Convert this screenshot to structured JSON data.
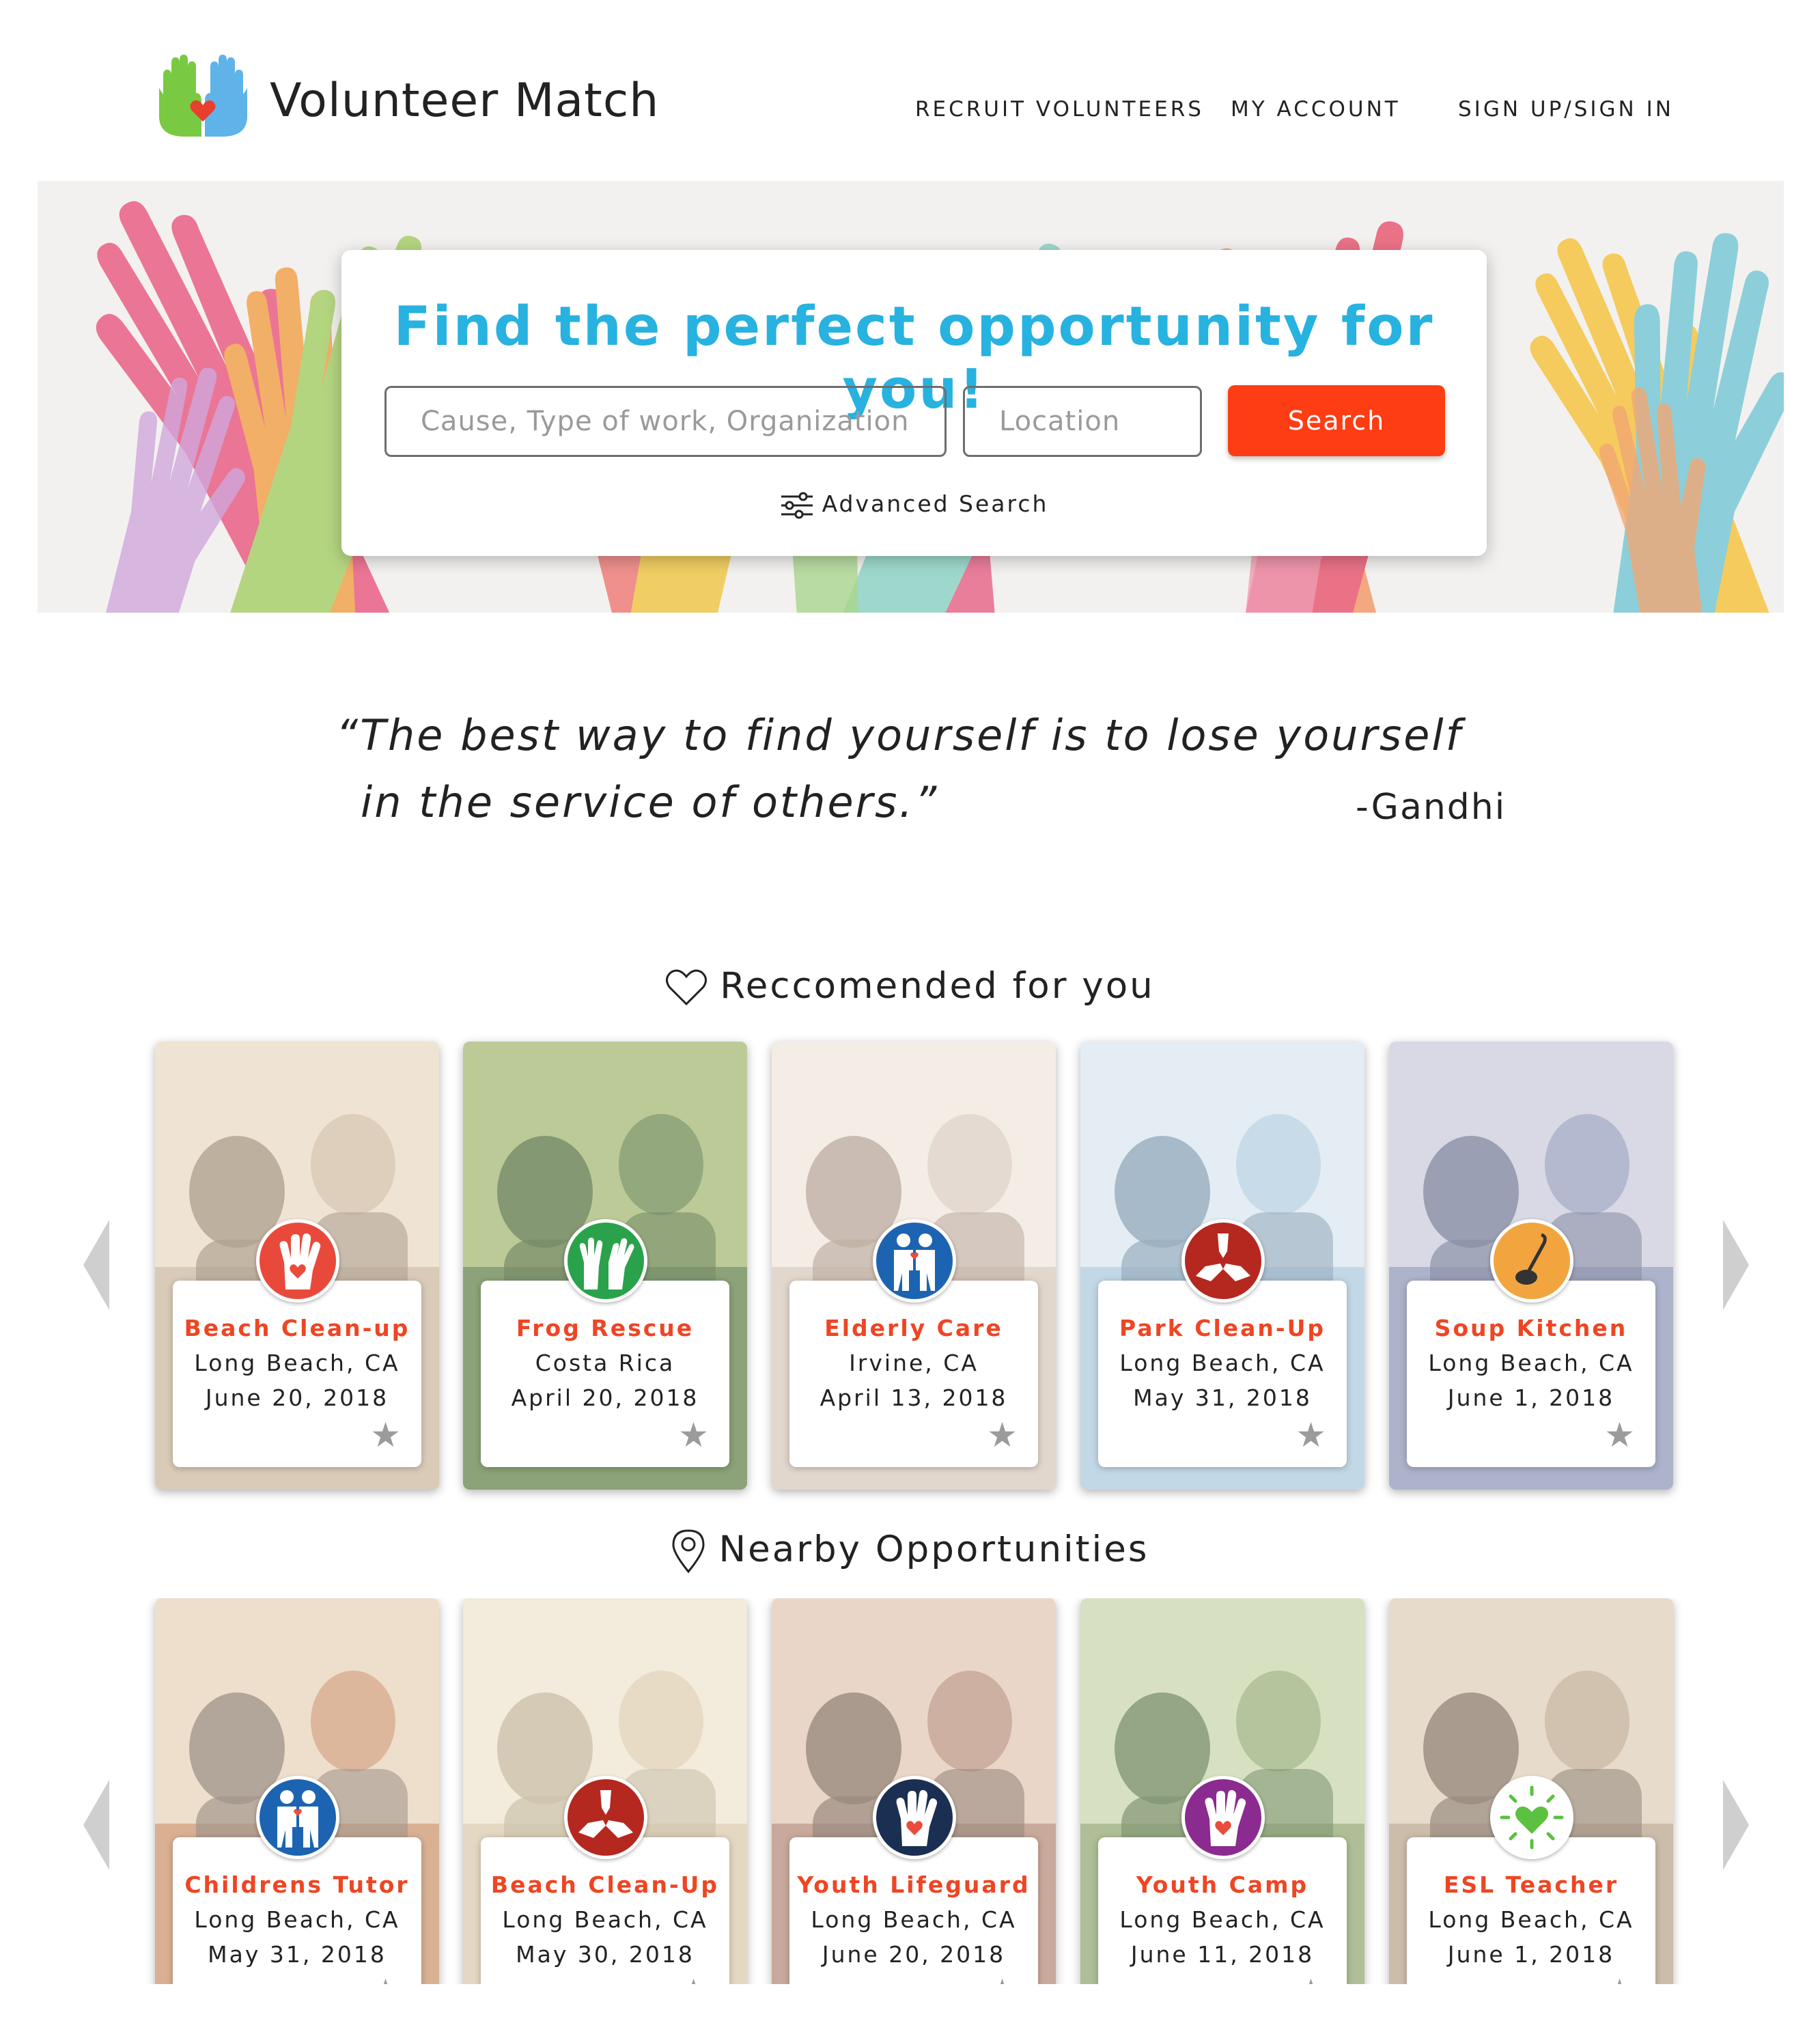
{
  "header": {
    "brand": "Volunteer Match",
    "nav": [
      "RECRUIT VOLUNTEERS",
      "MY ACCOUNT",
      "SIGN UP/SIGN IN"
    ]
  },
  "hero": {
    "title": "Find the perfect opportunity for you!",
    "cause_placeholder": "Cause, Type of work, Organization",
    "location_placeholder": "Location",
    "search_label": "Search",
    "advanced_label": "Advanced Search"
  },
  "quote": {
    "line1": "“The best way to find yourself is to lose yourself",
    "line2": "in the service of others.”",
    "author": "-Gandhi"
  },
  "recommended": {
    "title": "Reccomended for you",
    "cards": [
      {
        "title": "Beach Clean-up",
        "location": "Long Beach, CA",
        "date": "June 20, 2018",
        "icon": "hand-heart-icon",
        "color": "#e9493b"
      },
      {
        "title": "Frog Rescue",
        "location": "Costa Rica",
        "date": "April 20, 2018",
        "icon": "raised-hands-icon",
        "color": "#2aa24b"
      },
      {
        "title": "Elderly Care",
        "location": "Irvine, CA",
        "date": "April 13, 2018",
        "icon": "people-icon",
        "color": "#1c64b1"
      },
      {
        "title": "Park Clean-Up",
        "location": "Long Beach, CA",
        "date": "May 31, 2018",
        "icon": "joined-hands-icon",
        "color": "#b5281f"
      },
      {
        "title": "Soup Kitchen",
        "location": "Long Beach, CA",
        "date": "June 1, 2018",
        "icon": "ladle-icon",
        "color": "#f2a53f"
      }
    ]
  },
  "nearby": {
    "title": "Nearby Opportunities",
    "cards": [
      {
        "title": "Childrens Tutor",
        "location": "Long Beach, CA",
        "date": "May 31, 2018",
        "icon": "people-icon",
        "color": "#1c64b1"
      },
      {
        "title": "Beach Clean-Up",
        "location": "Long Beach, CA",
        "date": "May 30, 2018",
        "icon": "joined-hands-icon",
        "color": "#b5281f"
      },
      {
        "title": "Youth Lifeguard",
        "location": "Long Beach, CA",
        "date": "June 20, 2018",
        "icon": "hand-heart-icon",
        "color": "#1b2f52"
      },
      {
        "title": "Youth Camp",
        "location": "Long Beach, CA",
        "date": "June 11, 2018",
        "icon": "hand-heart-icon",
        "color": "#8b2a8f"
      },
      {
        "title": "ESL Teacher",
        "location": "Long Beach, CA",
        "date": "June 1, 2018",
        "icon": "heart-icon",
        "color": "#ffffff"
      }
    ]
  }
}
